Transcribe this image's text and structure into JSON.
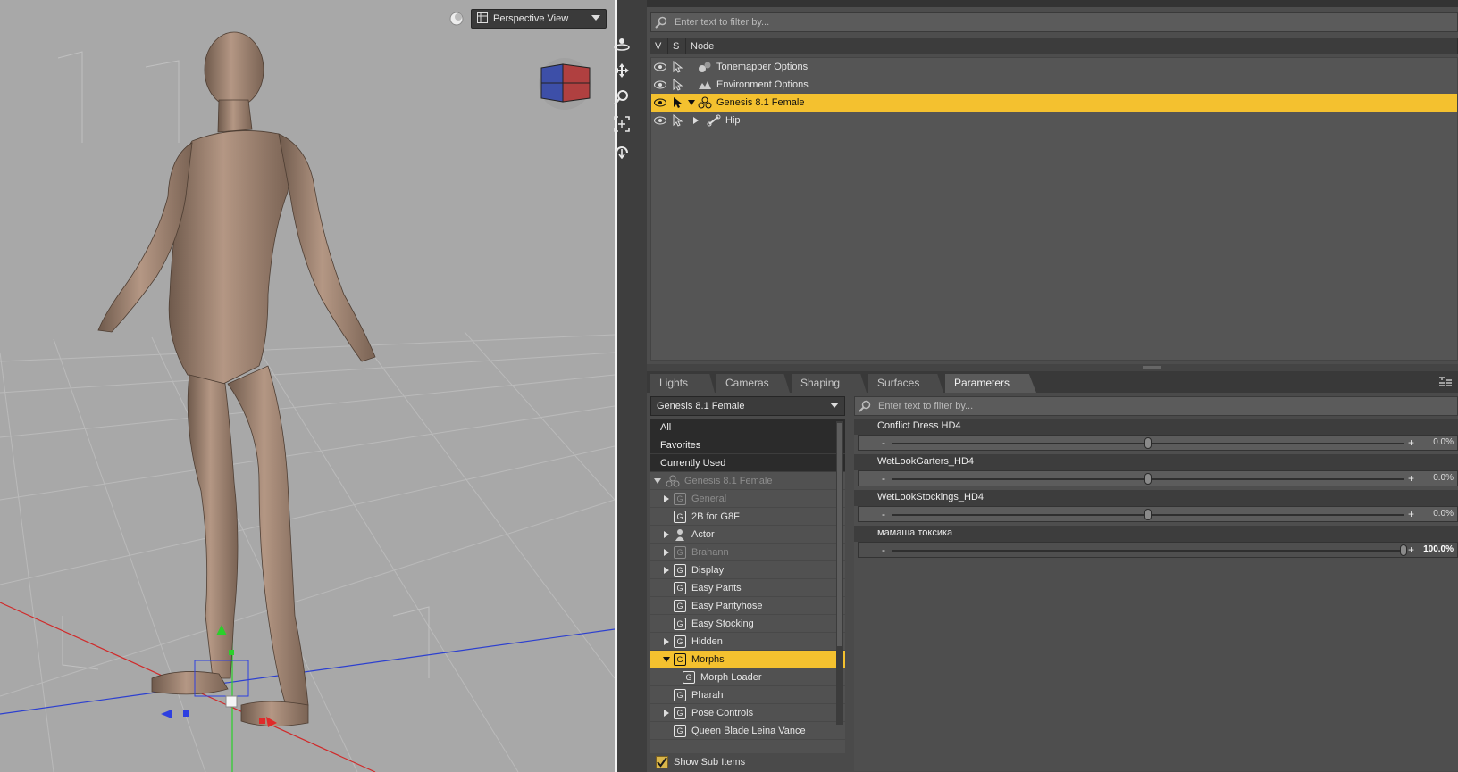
{
  "viewport": {
    "view_label": "Perspective View",
    "icons": [
      "sun-icon",
      "view-layout-icon",
      "chevron-down-icon",
      "orbit-icon",
      "pan-icon",
      "zoom-icon",
      "frame-icon",
      "reset-icon",
      "view-cube"
    ]
  },
  "scene": {
    "filter_placeholder": "Enter text to filter by...",
    "columns": [
      "V",
      "S",
      "Node"
    ],
    "nodes": [
      {
        "label": "Tonemapper Options",
        "icon": "tonemapper-icon",
        "level": 0,
        "selected": false
      },
      {
        "label": "Environment Options",
        "icon": "environment-icon",
        "level": 0,
        "selected": false
      },
      {
        "label": "Genesis 8.1 Female",
        "icon": "figure-icon",
        "level": 0,
        "selected": true,
        "expanded": true
      },
      {
        "label": "Hip",
        "icon": "bone-icon",
        "level": 1,
        "selected": false,
        "expanded": false
      }
    ]
  },
  "tabs": [
    "Lights",
    "Cameras",
    "Shaping",
    "Surfaces",
    "Parameters"
  ],
  "active_tab": "Parameters",
  "parameters": {
    "node_select": "Genesis 8.1 Female",
    "filter_placeholder": "Enter text to filter by...",
    "top_categories": [
      "All",
      "Favorites",
      "Currently Used"
    ],
    "tree": [
      {
        "label": "Genesis 8.1 Female",
        "expander": "open",
        "dim": true,
        "icon": "figure",
        "indent": 0
      },
      {
        "label": "General",
        "expander": "closed",
        "dim": true,
        "indent": 1
      },
      {
        "label": "2B for G8F",
        "expander": "none",
        "indent": 1
      },
      {
        "label": "Actor",
        "expander": "closed",
        "icon": "actor",
        "indent": 1
      },
      {
        "label": "Brahann",
        "expander": "closed",
        "dim": true,
        "indent": 1
      },
      {
        "label": "Display",
        "expander": "closed",
        "indent": 1
      },
      {
        "label": "Easy Pants",
        "expander": "none",
        "indent": 1
      },
      {
        "label": "Easy Pantyhose",
        "expander": "none",
        "indent": 1
      },
      {
        "label": "Easy Stocking",
        "expander": "none",
        "indent": 1
      },
      {
        "label": "Hidden",
        "expander": "closed",
        "indent": 1
      },
      {
        "label": "Morphs",
        "expander": "open",
        "selected": true,
        "indent": 1
      },
      {
        "label": "Morph Loader",
        "expander": "none",
        "indent": 2
      },
      {
        "label": "Pharah",
        "expander": "none",
        "indent": 1
      },
      {
        "label": "Pose Controls",
        "expander": "closed",
        "indent": 1
      },
      {
        "label": "Queen Blade Leina Vance",
        "expander": "none",
        "indent": 1
      }
    ],
    "show_sub_items": "Show Sub Items",
    "show_sub_items_checked": true,
    "sliders": [
      {
        "name": "Conflict Dress HD4",
        "value": "0.0%",
        "level": 0.5,
        "minus": "-",
        "plus": "+"
      },
      {
        "name": "WetLookGarters_HD4",
        "value": "0.0%",
        "level": 0.5,
        "minus": "-",
        "plus": "+"
      },
      {
        "name": "WetLookStockings_HD4",
        "value": "0.0%",
        "level": 0.5,
        "minus": "-",
        "plus": "+"
      },
      {
        "name": "мамаша токсика",
        "value": "100.0%",
        "level": 1.0,
        "minus": "-",
        "plus": "+",
        "active": true
      }
    ]
  },
  "colors": {
    "selection": "#f4c12f",
    "viewport_bg": "#a8a8a8",
    "panel_bg": "#4d4d4d"
  }
}
